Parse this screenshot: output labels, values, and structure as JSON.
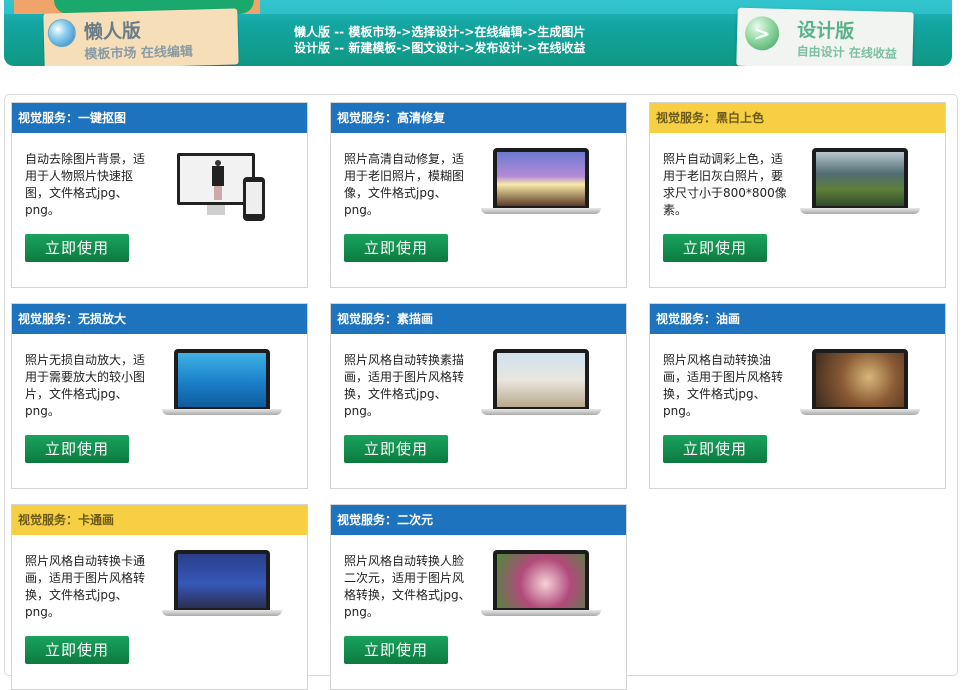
{
  "banner": {
    "lazy_title": "懒人版",
    "lazy_sub": "模板市场  在线编辑",
    "line1": "懒人版 -- 模板市场->选择设计->在线编辑->生成图片",
    "line2": "设计版 -- 新建模板->图文设计->发布设计->在线收益",
    "design_title": "设计版",
    "design_sub": "自由设计  在线收益",
    "design_icon": "arrow-right-icon"
  },
  "button_label": "立即使用",
  "cards": [
    {
      "title": "视觉服务：一键抠图",
      "desc": "自动去除图片背景，适用于人物照片快速抠图，文件格式jpg、png。",
      "header_color": "#1e73be"
    },
    {
      "title": "视觉服务：高清修复",
      "desc": "照片高清自动修复，适用于老旧照片，模糊图像，文件格式jpg、png。",
      "header_color": "#1e73be"
    },
    {
      "title": "视觉服务：黑白上色",
      "desc": "照片自动调彩上色，适用于老旧灰白照片，要求尺寸小于800*800像素。",
      "header_color": "#f6cf43"
    },
    {
      "title": "视觉服务：无损放大",
      "desc": "照片无损自动放大，适用于需要放大的较小图片，文件格式jpg、png。",
      "header_color": "#1e73be"
    },
    {
      "title": "视觉服务：素描画",
      "desc": "照片风格自动转换素描画，适用于图片风格转换，文件格式jpg、png。",
      "header_color": "#1e73be"
    },
    {
      "title": "视觉服务：油画",
      "desc": "照片风格自动转换油画，适用于图片风格转换，文件格式jpg、png。",
      "header_color": "#1e73be"
    },
    {
      "title": "视觉服务：卡通画",
      "desc": "照片风格自动转换卡通画，适用于图片风格转换，文件格式jpg、png。",
      "header_color": "#f6cf43"
    },
    {
      "title": "视觉服务：二次元",
      "desc": "照片风格自动转换人脸二次元，适用于图片风格转换，文件格式jpg、png。",
      "header_color": "#1e73be"
    }
  ]
}
